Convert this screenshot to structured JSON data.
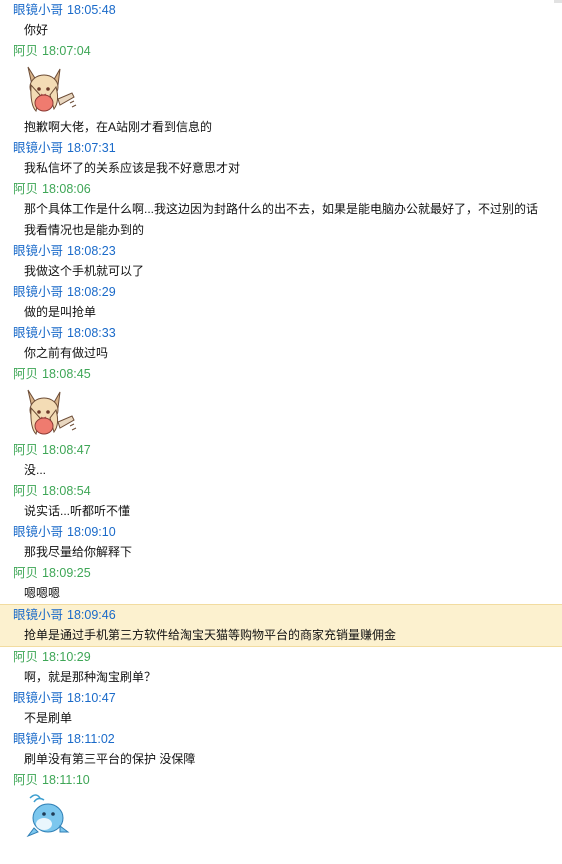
{
  "messages": [
    {
      "who": "me",
      "sender": "眼镜小哥",
      "time": "18:05:48",
      "text": "你好"
    },
    {
      "who": "other",
      "sender": "阿贝",
      "time": "18:07:04",
      "sticker": "anime-girl-sticker"
    },
    {
      "who": "other",
      "sender": "",
      "time": "",
      "text": "抱歉啊大佬，在A站刚才看到信息的"
    },
    {
      "who": "me",
      "sender": "眼镜小哥",
      "time": "18:07:31",
      "text": "我私信坏了的关系应该是我不好意思才对"
    },
    {
      "who": "other",
      "sender": "阿贝",
      "time": "18:08:06",
      "text": "那个具体工作是什么啊...我这边因为封路什么的出不去，如果是能电脑办公就最好了，不过别的话我看情况也是能办到的"
    },
    {
      "who": "me",
      "sender": "眼镜小哥",
      "time": "18:08:23",
      "text": "我做这个手机就可以了"
    },
    {
      "who": "me",
      "sender": "眼镜小哥",
      "time": "18:08:29",
      "text": "做的是叫抢单"
    },
    {
      "who": "me",
      "sender": "眼镜小哥",
      "time": "18:08:33",
      "text": "你之前有做过吗"
    },
    {
      "who": "other",
      "sender": "阿贝",
      "time": "18:08:45",
      "sticker": "anime-girl-sticker"
    },
    {
      "who": "other",
      "sender": "阿贝",
      "time": "18:08:47",
      "text": "没..."
    },
    {
      "who": "other",
      "sender": "阿贝",
      "time": "18:08:54",
      "text": "说实话...听都听不懂"
    },
    {
      "who": "me",
      "sender": "眼镜小哥",
      "time": "18:09:10",
      "text": "那我尽量给你解释下"
    },
    {
      "who": "other",
      "sender": "阿贝",
      "time": "18:09:25",
      "text": "嗯嗯嗯"
    },
    {
      "who": "me",
      "sender": "眼镜小哥",
      "time": "18:09:46",
      "text": "抢单是通过手机第三方软件给淘宝天猫等购物平台的商家充销量赚佣金",
      "highlight": true
    },
    {
      "who": "other",
      "sender": "阿贝",
      "time": "18:10:29",
      "text": "啊，就是那种淘宝刷单？"
    },
    {
      "who": "me",
      "sender": "眼镜小哥",
      "time": "18:10:47",
      "text": "不是刷单"
    },
    {
      "who": "me",
      "sender": "眼镜小哥",
      "time": "18:11:02",
      "text": "刷单没有第三平台的保护 没保障"
    },
    {
      "who": "other",
      "sender": "阿贝",
      "time": "18:11:10",
      "sticker": "dolphin-sticker"
    }
  ],
  "colors": {
    "me_header": "#1a6ac9",
    "other_header": "#3ea656",
    "highlight_bg": "#fcf1cf"
  }
}
